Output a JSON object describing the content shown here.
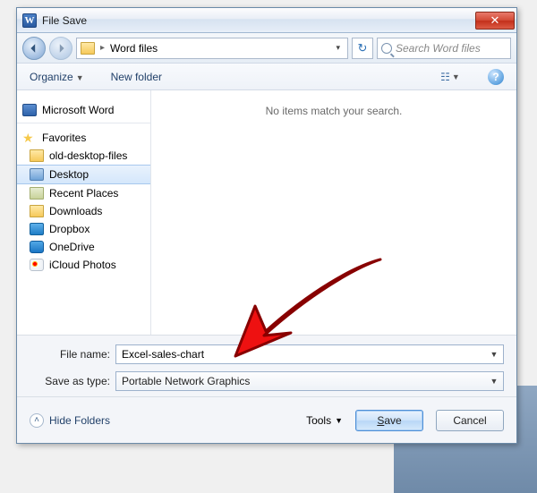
{
  "title": "File Save",
  "nav": {
    "crumb_sep": "▸",
    "current_folder": "Word files",
    "search_placeholder": "Search Word files"
  },
  "toolbar": {
    "organize": "Organize",
    "newfolder": "New folder"
  },
  "sidebar": {
    "app": "Microsoft Word",
    "fav_header": "Favorites",
    "items": [
      {
        "label": "old-desktop-files"
      },
      {
        "label": "Desktop"
      },
      {
        "label": "Recent Places"
      },
      {
        "label": "Downloads"
      },
      {
        "label": "Dropbox"
      },
      {
        "label": "OneDrive"
      },
      {
        "label": "iCloud Photos"
      }
    ]
  },
  "content": {
    "empty": "No items match your search."
  },
  "fields": {
    "filename_label": "File name:",
    "filename_value": "Excel-sales-chart",
    "type_label": "Save as type:",
    "type_value": "Portable Network Graphics"
  },
  "footer": {
    "hide": "Hide Folders",
    "tools": "Tools",
    "save": "Save",
    "cancel": "Cancel"
  }
}
